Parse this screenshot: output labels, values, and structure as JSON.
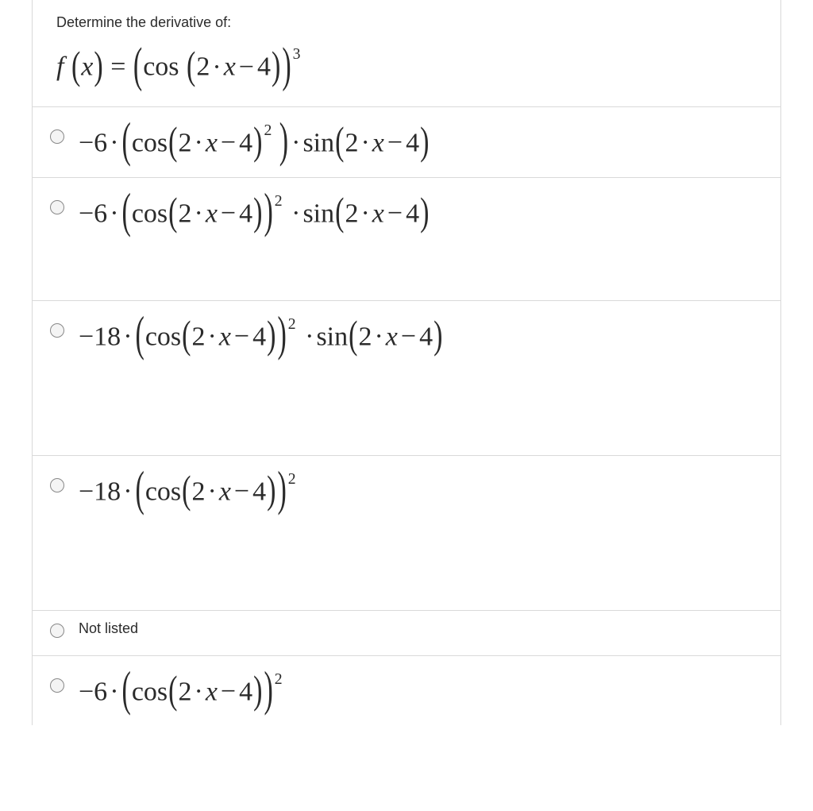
{
  "question": {
    "prompt": "Determine the derivative of:",
    "function_repr": "f(x) = (cos(2·x − 4))^3",
    "func": {
      "outer_exp": "3",
      "inner": "2·x − 4",
      "lead": "f",
      "arg": "x"
    }
  },
  "options": [
    {
      "id": "opt1",
      "type": "math",
      "repr": "−6·( cos(2·x − 4)^2 )·sin(2·x − 4)",
      "coef": "−6",
      "inner_sq_on_arg": true,
      "outer_exp": "2",
      "has_sin": true
    },
    {
      "id": "opt2",
      "type": "math",
      "repr": "−6·( cos(2·x − 4) )^2 · sin(2·x − 4)",
      "coef": "−6",
      "inner_sq_on_arg": false,
      "outer_exp": "2",
      "has_sin": true
    },
    {
      "id": "opt3",
      "type": "math",
      "repr": "−18·( cos(2·x − 4) )^2 · sin(2·x − 4)",
      "coef": "−18",
      "inner_sq_on_arg": false,
      "outer_exp": "2",
      "has_sin": true
    },
    {
      "id": "opt4",
      "type": "math",
      "repr": "−18·( cos(2·x − 4) )^2",
      "coef": "−18",
      "inner_sq_on_arg": false,
      "outer_exp": "2",
      "has_sin": false
    },
    {
      "id": "opt5",
      "type": "text",
      "repr": "Not listed",
      "label": "Not listed"
    },
    {
      "id": "opt6",
      "type": "math",
      "repr": "−6·( cos(2·x − 4) )^2",
      "coef": "−6",
      "inner_sq_on_arg": false,
      "outer_exp": "2",
      "has_sin": false
    }
  ],
  "shared": {
    "cos": "cos",
    "sin": "sin",
    "two": "2",
    "four": "4",
    "x": "x",
    "mul": "·",
    "minus": "−"
  }
}
